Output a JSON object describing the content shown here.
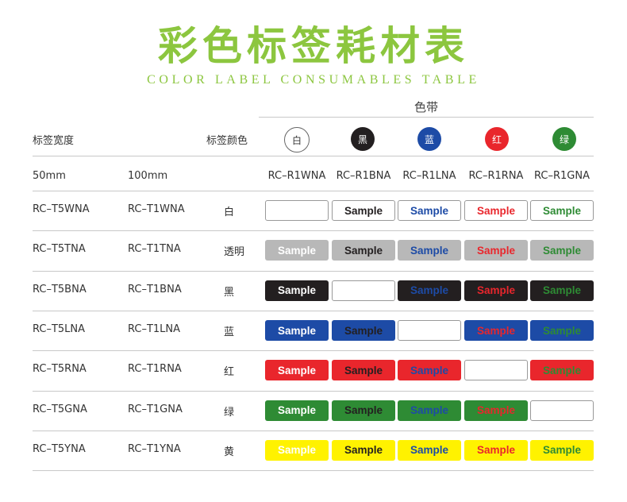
{
  "title": "彩色标签耗材表",
  "subtitle": "COLOR LABEL CONSUMABLES TABLE",
  "header": {
    "ribbon_group": "色带",
    "label_width": "标签宽度",
    "label_color": "标签颜色",
    "width_50": "50mm",
    "width_100": "100mm"
  },
  "ribbons": [
    {
      "name": "白",
      "model": "RC–R1WNA",
      "color": "#ffffff",
      "text_color": "#333333"
    },
    {
      "name": "黑",
      "model": "RC–R1BNA",
      "color": "#231f20",
      "text_color": "#ffffff"
    },
    {
      "name": "蓝",
      "model": "RC–R1LNA",
      "color": "#1d4ba6",
      "text_color": "#ffffff"
    },
    {
      "name": "红",
      "model": "RC–R1RNA",
      "color": "#e9262c",
      "text_color": "#ffffff"
    },
    {
      "name": "绿",
      "model": "RC–R1GNA",
      "color": "#2e8b34",
      "text_color": "#ffffff"
    }
  ],
  "sample_text": "Sample",
  "rows": [
    {
      "model_50": "RC–T5WNA",
      "model_100": "RC–T1WNA",
      "color_name": "白",
      "bg": "#ffffff"
    },
    {
      "model_50": "RC–T5TNA",
      "model_100": "RC–T1TNA",
      "color_name": "透明",
      "bg": "#b8b8b8"
    },
    {
      "model_50": "RC–T5BNA",
      "model_100": "RC–T1BNA",
      "color_name": "黑",
      "bg": "#231f20"
    },
    {
      "model_50": "RC–T5LNA",
      "model_100": "RC–T1LNA",
      "color_name": "蓝",
      "bg": "#1d4ba6"
    },
    {
      "model_50": "RC–T5RNA",
      "model_100": "RC–T1RNA",
      "color_name": "红",
      "bg": "#e9262c"
    },
    {
      "model_50": "RC–T5GNA",
      "model_100": "RC–T1GNA",
      "color_name": "绿",
      "bg": "#2e8b34"
    },
    {
      "model_50": "RC–T5YNA",
      "model_100": "RC–T1YNA",
      "color_name": "黄",
      "bg": "#fff200"
    }
  ],
  "colors": {
    "title_green": "#8cc63f",
    "line_gray": "#c8c8c8",
    "blank_border": "#999999"
  }
}
